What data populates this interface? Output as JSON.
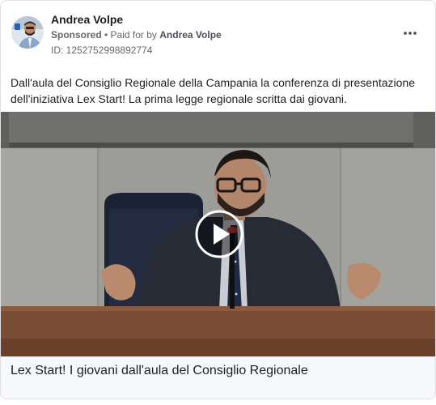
{
  "post": {
    "author_name": "Andrea Volpe",
    "sponsored_label": "Sponsored",
    "separator": " • ",
    "paid_for_prefix": "Paid for by ",
    "payer_name": "Andrea Volpe",
    "ad_id": "ID: 1252752998892774",
    "more_icon": "more-options-icon",
    "body_text": "Dall'aula del Consiglio Regionale della Campania la conferenza di presentazione dell'iniziativa Lex Start! La prima legge regionale scritta dai giovani.",
    "play_icon": "play-icon",
    "caption": "Lex Start! I giovani dall'aula del Consiglio Regionale"
  }
}
